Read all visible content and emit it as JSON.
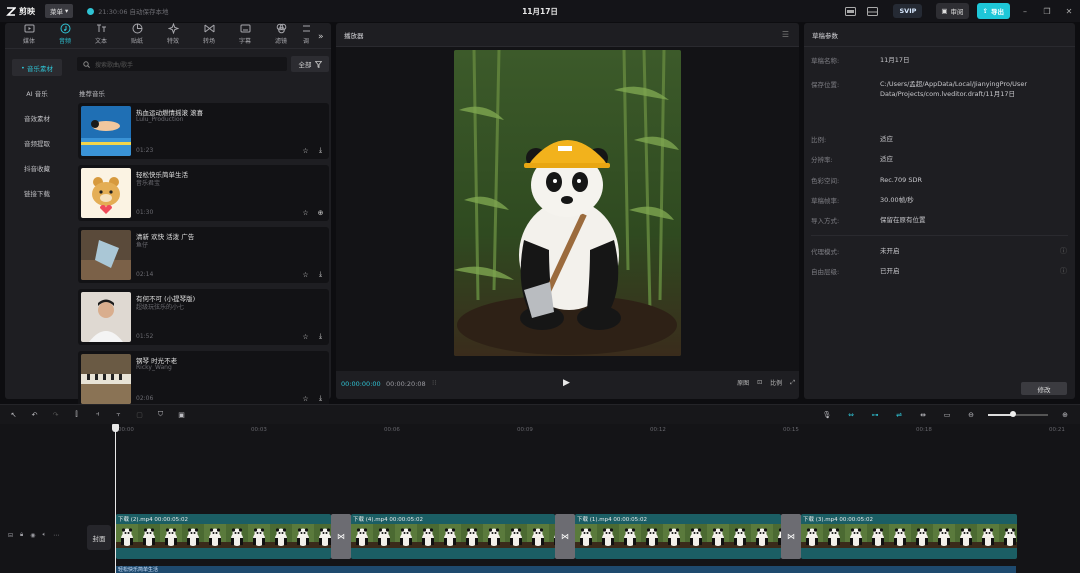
{
  "app": {
    "name": "剪映",
    "menu_label": "菜单",
    "autosave": "21:30:06 自动保存本地",
    "project_title": "11月17日",
    "svip": "SVIP",
    "review": "审阅",
    "export": "导出"
  },
  "left_panel": {
    "tabs": [
      {
        "label": "媒体",
        "icon": "media-icon"
      },
      {
        "label": "音频",
        "icon": "audio-icon"
      },
      {
        "label": "文本",
        "icon": "text-icon"
      },
      {
        "label": "贴纸",
        "icon": "sticker-icon"
      },
      {
        "label": "特效",
        "icon": "effect-icon"
      },
      {
        "label": "转场",
        "icon": "transition-icon"
      },
      {
        "label": "字幕",
        "icon": "caption-icon"
      },
      {
        "label": "滤镜",
        "icon": "filter-icon"
      },
      {
        "label": "调",
        "icon": "adjust-icon"
      }
    ],
    "categories": [
      "音乐素材",
      "AI 音乐",
      "音效素材",
      "音频提取",
      "抖音收藏",
      "链接下载"
    ],
    "search_placeholder": "搜索歌曲/歌手",
    "filter_label": "全部",
    "section_title": "推荐音乐",
    "music": [
      {
        "title": "热血运动燃情摇滚  滚喜",
        "artist": "Lulu_Production",
        "duration": "01:23"
      },
      {
        "title": "轻松快乐简单生活",
        "artist": "音乐君宝",
        "duration": "01:30"
      },
      {
        "title": "清新 欢快 活泼 广告",
        "artist": "鱼仔",
        "duration": "02:14"
      },
      {
        "title": "有何不可 (小提琴版)",
        "artist": "超级玩弦乐的小七",
        "duration": "01:52"
      },
      {
        "title": "钢琴 时光不老",
        "artist": "Ricky_Wang",
        "duration": "02:06"
      }
    ]
  },
  "player": {
    "title": "播放器",
    "time_current": "00:00:00:00",
    "time_total": "00:00:20:08",
    "ctrl_labels": [
      "原图",
      "比例"
    ]
  },
  "draft": {
    "title": "草稿参数",
    "rows": [
      {
        "k": "草稿名称:",
        "v": "11月17日"
      },
      {
        "k": "保存位置:",
        "v": "C:/Users/孟超/AppData/Local/JianyingPro/User Data/Projects/com.lveditor.draft/11月17日"
      },
      {
        "k": "比例:",
        "v": "适应"
      },
      {
        "k": "分辨率:",
        "v": "适应"
      },
      {
        "k": "色彩空间:",
        "v": "Rec.709 SDR"
      },
      {
        "k": "草稿帧率:",
        "v": "30.00帧/秒"
      },
      {
        "k": "导入方式:",
        "v": "保留在原有位置"
      },
      {
        "k": "代理模式:",
        "v": "未开启"
      },
      {
        "k": "自由层级:",
        "v": "已开启"
      }
    ],
    "modify": "修改"
  },
  "timeline": {
    "ruler": [
      "00:00",
      "00:03",
      "00:06",
      "00:09",
      "00:12",
      "00:15",
      "00:18",
      "00:21"
    ],
    "cover": "封面",
    "clips": [
      {
        "label": "下载 (2).mp4   00:00:05:02"
      },
      {
        "label": "下载 (4).mp4   00:00:05:02"
      },
      {
        "label": "下载 (1).mp4   00:00:05:02"
      },
      {
        "label": "下载 (3).mp4   00:00:05:02"
      }
    ],
    "audio_label": "轻松快乐简单生活",
    "zoom": 0.42
  },
  "colors": {
    "accent": "#2fc3d4",
    "clip": "#1b5e64",
    "audio": "#1e4a6e"
  }
}
